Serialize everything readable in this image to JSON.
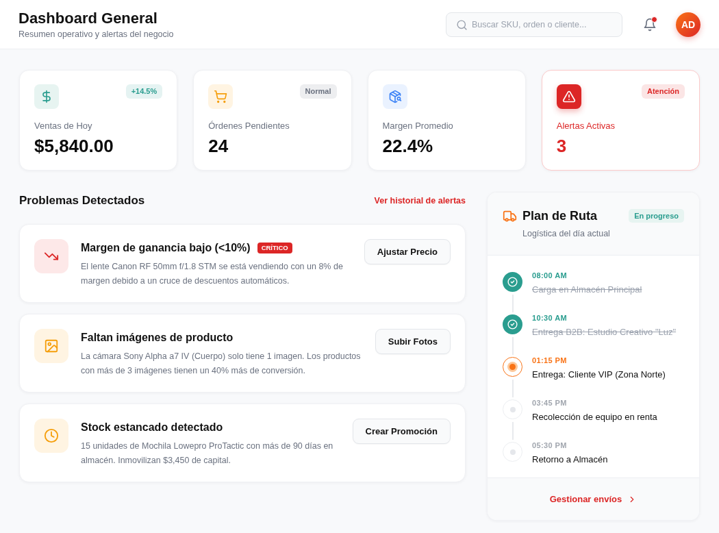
{
  "header": {
    "title": "Dashboard General",
    "subtitle": "Resumen operativo y alertas del negocio",
    "search": {
      "placeholder": "Buscar SKU, orden o cliente..."
    },
    "notifications": {
      "unread": true
    },
    "avatar": {
      "initials": "AD"
    }
  },
  "stats": [
    {
      "kind": "sales",
      "label": "Ventas de Hoy",
      "value": "$5,840.00",
      "badge": {
        "text": "+14.5%",
        "color": "#2a9d8f"
      },
      "alert": false
    },
    {
      "kind": "orders",
      "label": "Órdenes Pendientes",
      "value": "24",
      "badge": {
        "text": "Normal",
        "color": "#6b7280"
      },
      "alert": false
    },
    {
      "kind": "margin",
      "label": "Margen Promedio",
      "value": "22.4%",
      "alert": false
    },
    {
      "kind": "alerts",
      "label": "Alertas Activas",
      "value": "3",
      "badge": {
        "text": "Atención",
        "color": "#dc2626"
      },
      "alert": true
    }
  ],
  "problems": {
    "title": "Problemas Detectados",
    "link": "Ver historial de alertas",
    "items": [
      {
        "kind": "margin",
        "title": "Margen de ganancia bajo (<10%)",
        "tag": "CRÍTICO",
        "description": "El lente Canon RF 50mm f/1.8 STM se está vendiendo con un 8% de margen debido a un cruce de descuentos automáticos.",
        "action": "Ajustar Precio"
      },
      {
        "kind": "images",
        "title": "Faltan imágenes de producto",
        "description": "La cámara Sony Alpha a7 IV (Cuerpo) solo tiene 1 imagen. Los productos con más de 3 imágenes tienen un 40% más de conversión.",
        "action": "Subir Fotos"
      },
      {
        "kind": "stock",
        "title": "Stock estancado detectado",
        "description": "15 unidades de Mochila Lowepro ProTactic con más de 90 días en almacén. Inmovilizan $3,450 de capital.",
        "action": "Crear Promoción"
      }
    ]
  },
  "route": {
    "title": "Plan de Ruta",
    "subtitle": "Logística del día actual",
    "status": "En progreso",
    "stops": [
      {
        "kind": "done",
        "time": "08:00 AM",
        "title": "Carga en Almacén Principal"
      },
      {
        "kind": "done",
        "time": "10:30 AM",
        "title": "Entrega B2B: Estudio Creativo \"Luz\""
      },
      {
        "kind": "current",
        "time": "01:15 PM",
        "title": "Entrega: Cliente VIP (Zona Norte)"
      },
      {
        "kind": "pending",
        "time": "03:45 PM",
        "title": "Recolección de equipo en renta"
      },
      {
        "kind": "pending",
        "time": "05:30 PM",
        "title": "Retorno a Almacén"
      }
    ],
    "link": "Gestionar envíos"
  }
}
